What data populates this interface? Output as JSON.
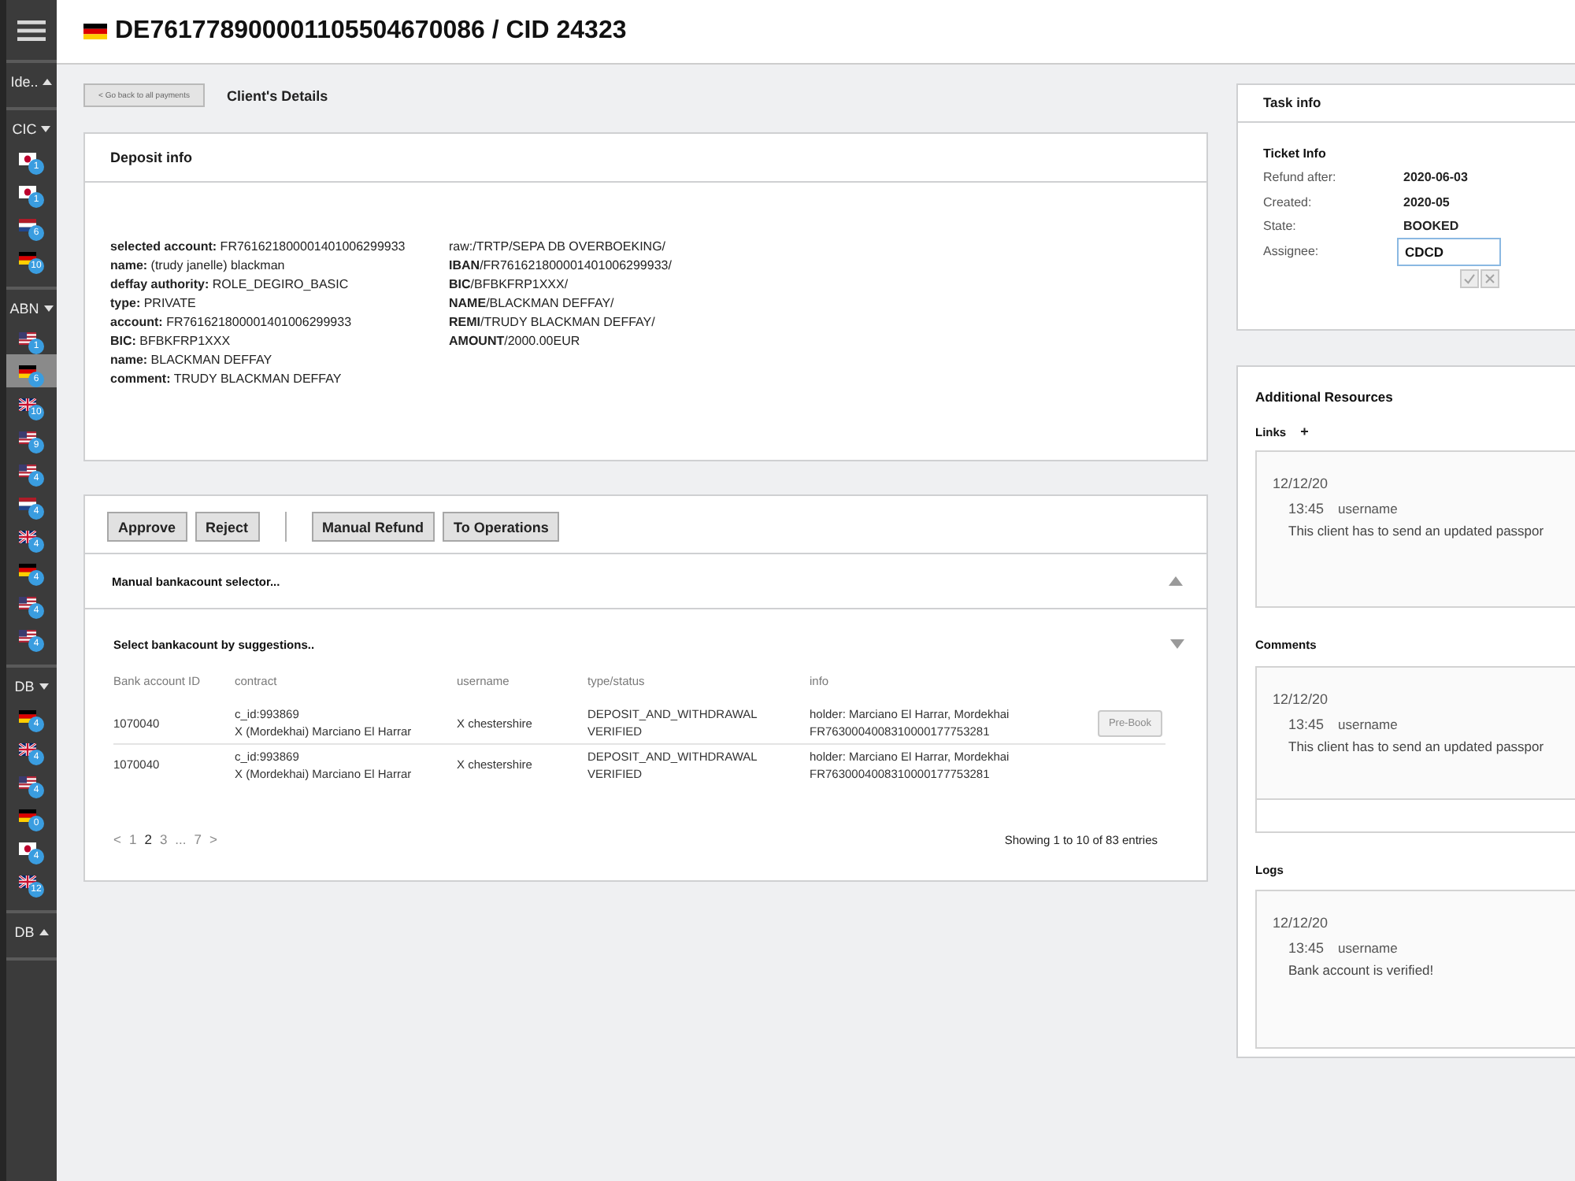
{
  "sidebar": {
    "groups": [
      {
        "label": "Ide..",
        "expanded": false
      },
      {
        "label": "CIC",
        "expanded": true,
        "items": [
          {
            "kind": "japan",
            "count": "1",
            "selected": false
          },
          {
            "kind": "japan",
            "count": "1",
            "selected": false
          },
          {
            "kind": "netherlands",
            "count": "6",
            "selected": false
          },
          {
            "kind": "germany",
            "count": "10",
            "selected": false
          }
        ]
      },
      {
        "label": "ABN",
        "expanded": true,
        "items": [
          {
            "kind": "usa",
            "count": "1",
            "selected": false
          },
          {
            "kind": "germany",
            "count": "6",
            "selected": true
          },
          {
            "kind": "uk",
            "count": "10",
            "selected": false
          },
          {
            "kind": "usa",
            "count": "9",
            "selected": false
          },
          {
            "kind": "usa",
            "count": "4",
            "selected": false
          },
          {
            "kind": "netherlands",
            "count": "4",
            "selected": false
          },
          {
            "kind": "uk",
            "count": "4",
            "selected": false
          },
          {
            "kind": "germany",
            "count": "4",
            "selected": false
          },
          {
            "kind": "usa",
            "count": "4",
            "selected": false
          },
          {
            "kind": "usa",
            "count": "4",
            "selected": false
          }
        ]
      },
      {
        "label": "DB",
        "expanded": true,
        "items": [
          {
            "kind": "germany",
            "count": "4",
            "selected": false
          },
          {
            "kind": "uk",
            "count": "4",
            "selected": false
          },
          {
            "kind": "usa",
            "count": "4",
            "selected": false
          },
          {
            "kind": "germany",
            "count": "0",
            "selected": false
          },
          {
            "kind": "japan",
            "count": "4",
            "selected": false
          },
          {
            "kind": "uk",
            "count": "12",
            "selected": false
          }
        ]
      },
      {
        "label": "DB",
        "expanded": false
      }
    ]
  },
  "header": {
    "flag": {
      "kind": "germany"
    },
    "title": "DE761778900001105504670086 / CID 24323"
  },
  "back_button": "< Go back to all payments",
  "page_title": "Client's Details",
  "deposit_info": {
    "title": "Deposit info",
    "left_lines": [
      "**selected account:** FR761621800001401006299933",
      "**name:** (trudy janelle) blackman",
      "**deffay authority:** ROLE_DEGIRO_BASIC",
      "**type:** PRIVATE",
      "**account:** FR761621800001401006299933",
      "**BIC:** BFBKFRP1XXX",
      "**name:** BLACKMAN DEFFAY",
      "**comment:** TRUDY BLACKMAN DEFFAY"
    ],
    "right_lines": [
      "raw:/TRTP/SEPA DB OVERBOEKING/",
      "**IBAN**/FR761621800001401006299933/",
      "**BIC**/BFBKFRP1XXX/",
      "**NAME**/BLACKMAN DEFFAY/",
      "**REMI**/TRUDY BLACKMAN DEFFAY/",
      "**AMOUNT**/2000.00EUR"
    ]
  },
  "actions": {
    "button_groups": [
      [
        "Approve",
        "Reject"
      ],
      [
        "Manual Refund",
        "To Operations"
      ]
    ],
    "manual_selector": {
      "title": "Manual bankacount selector...",
      "expanded": false
    },
    "suggestions": {
      "title": "Select bankacount by suggestions..",
      "expanded": true,
      "table": {
        "columns": [
          "Bank account ID",
          "contract",
          "username",
          "type/status",
          "info"
        ],
        "rows": [
          {
            "cells": [
              "1070040",
              "c_id:993869\nX (Mordekhai) Marciano El Harrar",
              "X chestershire",
              "DEPOSIT_AND_WITHDRAWAL\nVERIFIED",
              "holder: Marciano El Harrar, Mordekhai\nFR7630004008310000177753281"
            ],
            "button": "Pre-Book"
          },
          {
            "cells": [
              "1070040",
              "c_id:993869\nX (Mordekhai) Marciano El Harrar",
              "X chestershire",
              "DEPOSIT_AND_WITHDRAWAL\nVERIFIED",
              "holder: Marciano El Harrar, Mordekhai\nFR7630004008310000177753281"
            ]
          }
        ]
      },
      "pagination": {
        "prev": "<",
        "pages": [
          {
            "label": "1",
            "selected": false
          },
          {
            "label": "2",
            "selected": true
          },
          {
            "label": "3",
            "selected": false
          },
          {
            "label": "...",
            "selected": false
          },
          {
            "label": "7",
            "selected": false
          }
        ],
        "next": ">",
        "summary": "Showing 1 to 10 of 83 entries"
      }
    }
  },
  "task_info": {
    "title": "Task info",
    "subtitle": "Ticket Info",
    "fields": [
      {
        "kind": "text",
        "label": "Refund after:",
        "value": "2020-06-03"
      },
      {
        "kind": "text",
        "label": "Created:",
        "value": "2020-05"
      },
      {
        "kind": "text",
        "label": "State:",
        "value": "BOOKED"
      },
      {
        "kind": "input",
        "label": "Assignee:",
        "value": "CDCD"
      }
    ]
  },
  "resources": {
    "title": "Additional Resources",
    "sections": [
      {
        "kind": "links",
        "label": "Links",
        "add": "+",
        "entries": [
          {
            "date": "12/12/20",
            "time": "13:45",
            "user": "username",
            "text": "This client has to send an updated passpor"
          }
        ]
      },
      {
        "kind": "comments",
        "label": "Comments",
        "entries": [
          {
            "date": "12/12/20",
            "time": "13:45",
            "user": "username",
            "text": "This client has to send an updated passpor"
          }
        ]
      },
      {
        "kind": "logs",
        "label": "Logs",
        "entries": [
          {
            "date": "12/12/20",
            "time": "13:45",
            "user": "username",
            "text": "Bank account is verified!"
          }
        ]
      }
    ]
  }
}
